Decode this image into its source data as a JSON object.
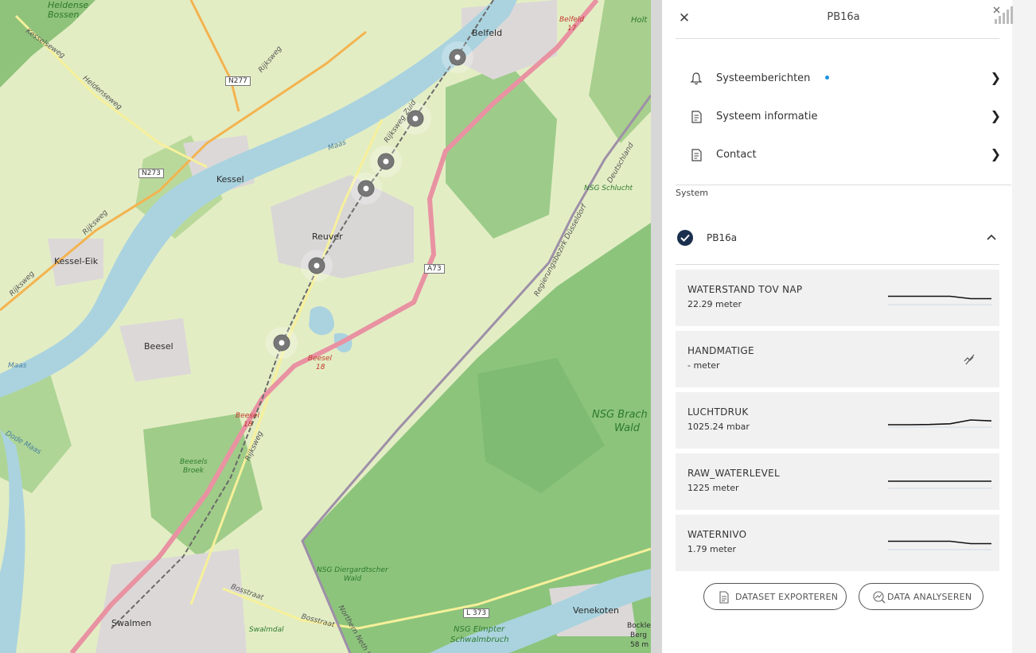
{
  "map": {
    "labels": {
      "heldense": "Heldense",
      "bossen": "Bossen",
      "kesselseweg": "Kesselseweg",
      "heldenseweg": "Heldenseweg",
      "n277": "N277",
      "rijksweg1": "Rijksweg",
      "n273": "N273",
      "kessel": "Kessel",
      "rijksweg2": "Rijksweg",
      "kessel_eik": "Kessel-Eik",
      "rijksweg3": "Rijksweg",
      "maas1": "Maas",
      "belfeld": "Belfeld",
      "belfeld17a": "Belfeld",
      "belfeld17b": "17",
      "holt": "Holt",
      "rijksweg_zuid": "Rijksweg Zuid",
      "reuver": "Reuver",
      "a73": "A73",
      "deutschland": "Deutschland",
      "nsg_schlucht": "NSG Schlucht",
      "regierung": "Regierungsbezirk Düsseldorf",
      "beesel": "Beesel",
      "maas2": "Maas",
      "beesel18a": "Beesel",
      "beesel18b": "18",
      "beesel18c": "Beesel",
      "beesel18d": "18",
      "rijksweg4": "Rijksweg",
      "dode_maas": "Dode Maas",
      "nsg_brach1": "NSG Brach",
      "nsg_brach2": "Wald",
      "beesels1": "Beesels",
      "beesels2": "Broek",
      "nsg_dier1": "NSG Diergardtscher",
      "nsg_dier2": "Wald",
      "bosstraat1": "Bosstraat",
      "bosstraat2": "Bosstraat",
      "l373": "L 373",
      "venekoten": "Venekoten",
      "swalmen": "Swalmen",
      "swalmdal": "Swalmdal",
      "nsg_elm1": "NSG Elmpter",
      "nsg_elm2": "Schwalmbruch",
      "northern": "Northern Neth W",
      "bockle1": "Bockle",
      "bockle2": "Berg",
      "bockle3": "58 m"
    },
    "station_markers": 6
  },
  "panel": {
    "title": "PB16a",
    "close_icon": "close-icon",
    "menu": [
      {
        "label": "Systeemberichten",
        "icon": "bell-icon",
        "has_notification": true
      },
      {
        "label": "Systeem informatie",
        "icon": "document-icon"
      },
      {
        "label": "Contact",
        "icon": "document-icon"
      }
    ],
    "section_label": "System",
    "system": {
      "name": "PB16a",
      "checked": true,
      "expanded": true
    },
    "sensors": [
      {
        "name": "WATERSTAND TOV NAP",
        "value": "22.29 meter",
        "trend": [
          0.55,
          0.55,
          0.55,
          0.55,
          0.45,
          0.45
        ]
      },
      {
        "name": "HANDMATIGE",
        "value": "- meter",
        "trend": null
      },
      {
        "name": "LUCHTDRUK",
        "value": "1025.24 mbar",
        "trend": [
          0.3,
          0.3,
          0.31,
          0.34,
          0.5,
          0.46
        ]
      },
      {
        "name": "RAW_WATERLEVEL",
        "value": "1225 meter",
        "trend": [
          0.5,
          0.5,
          0.5,
          0.5,
          0.5,
          0.5
        ]
      },
      {
        "name": "WATERNIVO",
        "value": "1.79 meter",
        "trend": [
          0.55,
          0.55,
          0.55,
          0.55,
          0.45,
          0.45
        ]
      }
    ],
    "buttons": {
      "export": "DATASET EXPORTEREN",
      "analyse": "DATA ANALYSEREN"
    },
    "accent_color": "#1c93e6",
    "check_color": "#1a2f4d"
  }
}
